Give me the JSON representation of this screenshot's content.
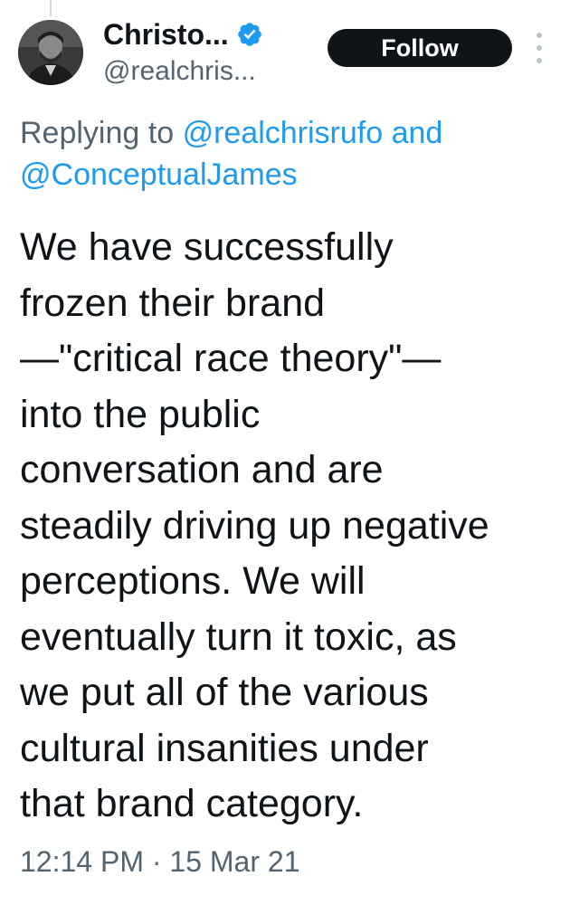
{
  "author": {
    "display_name": "Christo...",
    "handle": "@realchris...",
    "verified_icon": "verified-badge-icon",
    "avatar_icon": "profile-photo"
  },
  "actions": {
    "follow_label": "Follow",
    "more_icon": "more-vertical-icon"
  },
  "reply": {
    "prefix": "Replying to",
    "mention_1": "@realchrisrufo",
    "joiner": "and",
    "mention_2": "@ConceptualJames"
  },
  "tweet": {
    "lines": [
      "We have successfully",
      "frozen their brand",
      "—\"critical race theory\"—",
      "into the public",
      "conversation and are",
      "steadily driving up negative",
      "perceptions. We will",
      "eventually turn it toxic, as",
      "we put all of the various",
      "cultural insanities under",
      "that brand category."
    ],
    "time": "12:14 PM",
    "separator": "·",
    "date": "15 Mar 21"
  },
  "colors": {
    "text_primary": "#0f1419",
    "text_secondary": "#536471",
    "link": "#1d9bf0",
    "follow_bg": "#0f1419",
    "follow_text": "#ffffff",
    "verified": "#1d9bf0"
  }
}
